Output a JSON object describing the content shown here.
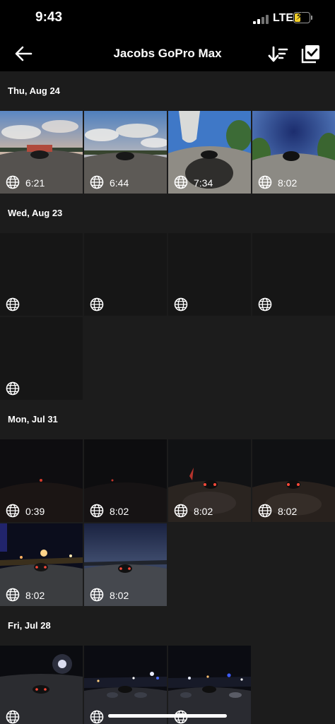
{
  "status": {
    "time": "9:43",
    "network": "LTE"
  },
  "nav": {
    "title": "Jacobs GoPro Max",
    "back_icon": "arrow-left-icon",
    "sort_icon": "sort-down-icon",
    "select_icon": "select-check-icon"
  },
  "sections": [
    {
      "date": "Thu, Aug 24",
      "items": [
        {
          "duration": "6:21",
          "scene": "day-sky-warm"
        },
        {
          "duration": "6:44",
          "scene": "day-clouds"
        },
        {
          "duration": "7:34",
          "scene": "day-blue-street"
        },
        {
          "duration": "8:02",
          "scene": "day-deep-blue"
        }
      ]
    },
    {
      "date": "Wed, Aug 23",
      "items": [
        {
          "duration": "",
          "scene": "blank"
        },
        {
          "duration": "",
          "scene": "blank"
        },
        {
          "duration": "",
          "scene": "blank"
        },
        {
          "duration": "",
          "scene": "blank"
        },
        {
          "duration": "",
          "scene": "blank"
        }
      ]
    },
    {
      "date": "Mon, Jul 31",
      "items": [
        {
          "duration": "0:39",
          "scene": "night-dark"
        },
        {
          "duration": "8:02",
          "scene": "night-dark"
        },
        {
          "duration": "8:02",
          "scene": "night-lights"
        },
        {
          "duration": "8:02",
          "scene": "night-lights"
        },
        {
          "duration": "8:02",
          "scene": "night-city"
        },
        {
          "duration": "8:02",
          "scene": "dusk-road"
        }
      ]
    },
    {
      "date": "Fri, Jul 28",
      "items": [
        {
          "duration": "",
          "scene": "night-streetlight"
        },
        {
          "duration": "",
          "scene": "night-crowd"
        },
        {
          "duration": "",
          "scene": "night-crowd"
        }
      ]
    }
  ],
  "colors": {
    "background": "#1c1c1c",
    "bar": "#000000",
    "battery": "#f5d12a"
  }
}
